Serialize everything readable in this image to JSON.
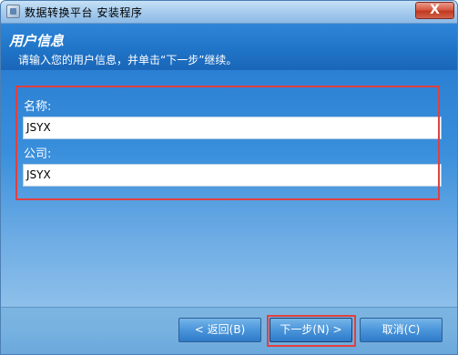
{
  "window": {
    "title": "数据转换平台 安装程序",
    "close_label": "X"
  },
  "header": {
    "title": "用户信息",
    "subtitle": "请输入您的用户信息，并单击“下一步”继续。"
  },
  "form": {
    "name_label": "名称:",
    "name_value": "JSYX",
    "company_label": "公司:",
    "company_value": "JSYX"
  },
  "buttons": {
    "back": "< 返回(B)",
    "next": "下一步(N) >",
    "cancel": "取消(C)"
  },
  "colors": {
    "accent": "#1f73c6",
    "highlight": "#e04040"
  }
}
